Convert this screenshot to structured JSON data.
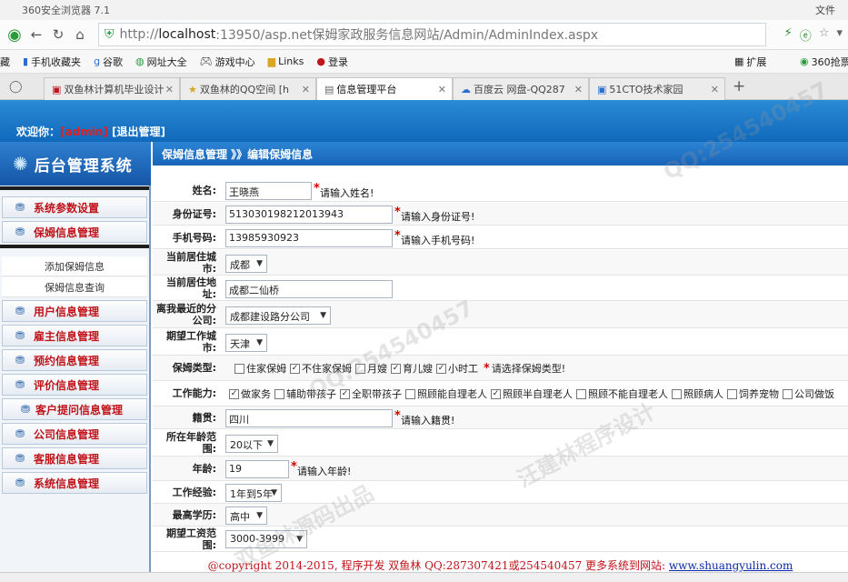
{
  "browser": {
    "title": "360安全浏览器 7.1",
    "menu_file": "文件",
    "address": {
      "scheme": "http://",
      "host": "localhost",
      "rest": ":13950/asp.net保姆家政服务信息网站/Admin/AdminIndex.aspx"
    },
    "bookmarks": [
      "藏",
      "手机收藏夹",
      "谷歌",
      "网址大全",
      "游戏中心",
      "Links",
      "登录",
      "扩展",
      "360抢票"
    ],
    "tabs": [
      {
        "label": "双鱼林计算机毕业设计",
        "active": false
      },
      {
        "label": "双鱼林的QQ空间 [h",
        "active": false
      },
      {
        "label": "信息管理平台",
        "active": true
      },
      {
        "label": "百度云 网盘-QQ287",
        "active": false
      },
      {
        "label": "51CTO技术家园",
        "active": false
      }
    ]
  },
  "header": {
    "welcome": "欢迎你：",
    "user": "[admin]",
    "logout": "[退出管理]"
  },
  "sidebar": {
    "logo": "后台管理系统",
    "menus_top": [
      "系统参数设置",
      "保姆信息管理"
    ],
    "sub_items": [
      "添加保姆信息",
      "保姆信息查询"
    ],
    "menus_bottom": [
      "用户信息管理",
      "雇主信息管理",
      "预约信息管理",
      "评价信息管理",
      "客户提问信息管理",
      "公司信息管理",
      "客服信息管理",
      "系统信息管理"
    ]
  },
  "breadcrumb": "保姆信息管理 》》编辑保姆信息",
  "form": {
    "name": {
      "label": "姓名:",
      "value": "王晓燕",
      "tip": "请输入姓名!"
    },
    "idcard": {
      "label": "身份证号:",
      "value": "513030198212013943",
      "tip": "请输入身份证号!"
    },
    "phone": {
      "label": "手机号码:",
      "value": "13985930923",
      "tip": "请输入手机号码!"
    },
    "city": {
      "label": "当前居住城市:",
      "value": "成都"
    },
    "address": {
      "label": "当前居住地址:",
      "value": "成都二仙桥"
    },
    "branch": {
      "label": "离我最近的分公司:",
      "value": "成都建设路分公司"
    },
    "work_city": {
      "label": "期望工作城市:",
      "value": "天津"
    },
    "type": {
      "label": "保姆类型:",
      "options": [
        {
          "text": "住家保姆",
          "checked": false
        },
        {
          "text": "不住家保姆",
          "checked": true
        },
        {
          "text": "月嫂",
          "checked": false
        },
        {
          "text": "育儿嫂",
          "checked": true
        },
        {
          "text": "小时工",
          "checked": true
        }
      ],
      "tip": "请选择保姆类型!"
    },
    "ability": {
      "label": "工作能力:",
      "options": [
        {
          "text": "做家务",
          "checked": true
        },
        {
          "text": "辅助带孩子",
          "checked": false
        },
        {
          "text": "全职带孩子",
          "checked": true
        },
        {
          "text": "照顾能自理老人",
          "checked": false
        },
        {
          "text": "照顾半自理老人",
          "checked": true
        },
        {
          "text": "照顾不能自理老人",
          "checked": false
        },
        {
          "text": "照顾病人",
          "checked": false
        },
        {
          "text": "饲养宠物",
          "checked": false
        },
        {
          "text": "公司做饭",
          "checked": false
        }
      ]
    },
    "native": {
      "label": "籍贯:",
      "value": "四川",
      "tip": "请输入籍贯!"
    },
    "age_range": {
      "label": "所在年龄范围:",
      "value": "20以下"
    },
    "age": {
      "label": "年龄:",
      "value": "19",
      "tip": "请输入年龄!"
    },
    "experience": {
      "label": "工作经验:",
      "value": "1年到5年"
    },
    "education": {
      "label": "最高学历:",
      "value": "高中"
    },
    "salary": {
      "label": "期望工资范围:",
      "value": "3000-3999"
    }
  },
  "footer": {
    "text": "@copyright 2014-2015, 程序开发 双鱼林  QQ:287307421或254540457 更多系统到网站: ",
    "link": "www.shuangyulin.com"
  },
  "watermarks": [
    "汪建林程序设计",
    "QQ:254540457",
    "双鱼林源码出品"
  ]
}
